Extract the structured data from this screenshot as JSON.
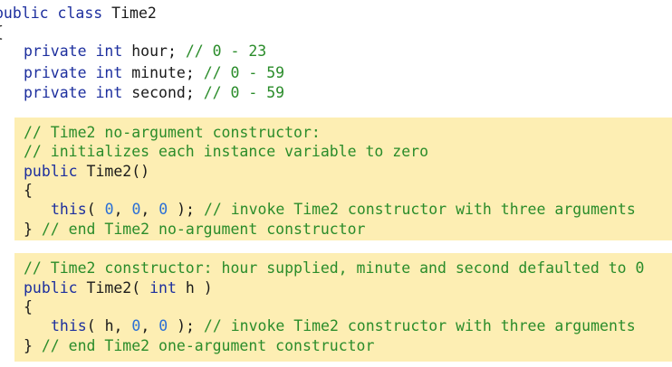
{
  "code": {
    "class_decl": {
      "kw": "public class",
      "name": " Time2"
    },
    "open_brace": "{",
    "fields": [
      {
        "kw": "private int",
        "name": " hour; ",
        "comment": "// 0 - 23"
      },
      {
        "kw": "private int",
        "name": " minute; ",
        "comment": "// 0 - 59"
      },
      {
        "kw": "private int",
        "name": " second; ",
        "comment": "// 0 - 59"
      }
    ],
    "ctor1": {
      "comment1": "// Time2 no-argument constructor:",
      "comment2": "// initializes each instance variable to zero",
      "sig_kw": "public",
      "sig_rest": " Time2()",
      "open": "{",
      "body_kw": "this",
      "body_p1": "( ",
      "n1": "0",
      "sep1": ", ",
      "n2": "0",
      "sep2": ", ",
      "n3": "0",
      "body_end": " ); ",
      "body_comment": "// invoke Time2 constructor with three arguments",
      "close": "}",
      "end_comment": " // end Time2 no-argument constructor"
    },
    "ctor2": {
      "comment1": "// Time2 constructor: hour supplied, minute and second defaulted to 0",
      "sig_kw": "public",
      "sig_mid": " Time2( ",
      "sig_kw2": "int",
      "sig_end": " h )",
      "open": "{",
      "body_kw": "this",
      "body_p1": "( h, ",
      "n2": "0",
      "sep2": ", ",
      "n3": "0",
      "body_end": " ); ",
      "body_comment": "// invoke Time2 constructor with three arguments",
      "close": "}",
      "end_comment": " // end Time2 one-argument constructor"
    }
  }
}
